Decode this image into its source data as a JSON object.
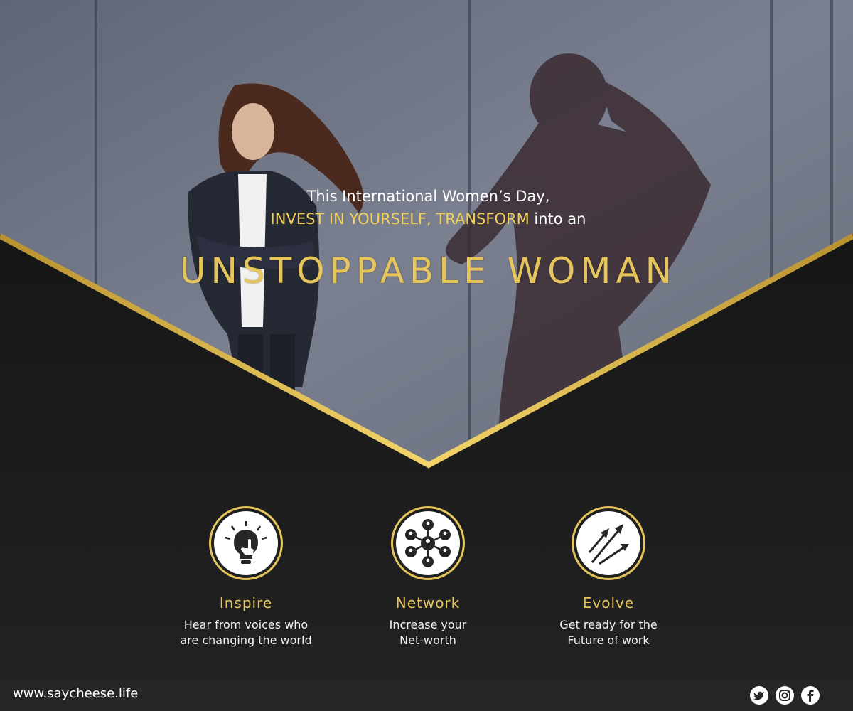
{
  "headline": {
    "line1": "This International Women’s Day,",
    "line2_highlight": "INVEST IN YOURSELF, TRANSFORM",
    "line2_rest": " into an",
    "title": "UNSTOPPABLE WOMAN"
  },
  "features": [
    {
      "icon": "lightbulb-hand-icon",
      "title": "Inspire",
      "description": "Hear from voices who\nare changing the world"
    },
    {
      "icon": "network-people-icon",
      "title": "Network",
      "description": "Increase your\nNet-worth"
    },
    {
      "icon": "rising-arrows-icon",
      "title": "Evolve",
      "description": "Get ready for the\nFuture of work"
    }
  ],
  "footer": {
    "website": "www.saycheese.life",
    "social": [
      "twitter-icon",
      "instagram-icon",
      "facebook-icon"
    ]
  },
  "colors": {
    "gold": "#e6c55c",
    "gold_light": "#f2d15a",
    "dark": "#1e1e1e",
    "footer": "#262626",
    "concrete": "#6a7180"
  }
}
